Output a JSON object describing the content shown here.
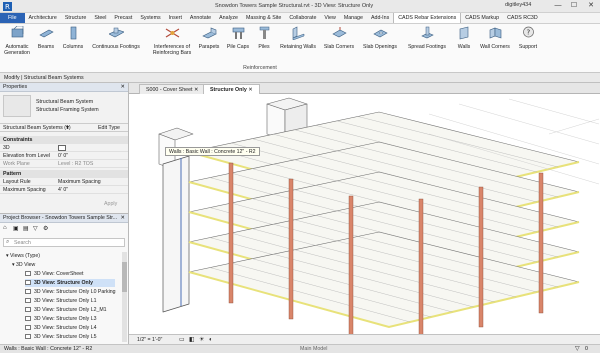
{
  "titlebar": {
    "title": "Snowdon Towers Sample Structural.rvt - 3D View: Structure Only",
    "user": "digitley434",
    "minimize": "—",
    "maximize": "☐",
    "close": "✕"
  },
  "tabs": [
    "File",
    "Architecture",
    "Structure",
    "Steel",
    "Precast",
    "Systems",
    "Insert",
    "Annotate",
    "Analyze",
    "Massing & Site",
    "Collaborate",
    "View",
    "Manage",
    "Add-Ins",
    "CADS Rebar Extensions",
    "CADS Markup",
    "CADS RC3D"
  ],
  "ribbon": {
    "buttons": [
      "Automatic Generation",
      "Beams",
      "Columns",
      "Continuous Footings",
      "Interferences of Reinforcing Bars",
      "Parapets",
      "Pile Caps",
      "Piles",
      "Retaining Walls",
      "Slab Corners",
      "Slab Openings",
      "Spread Footings",
      "Walls",
      "Wall Corners",
      "Support"
    ],
    "group_label": "Reinforcement"
  },
  "modbar": {
    "text": "Modify | Structural Beam Systems"
  },
  "properties": {
    "header": "Properties",
    "type_line1": "Structural Beam System",
    "type_line2": "Structural Framing System",
    "selector": "Structural Beam Systems (1)",
    "edit_type": "Edit Type",
    "cat_constraints": "Constraints",
    "rows_constraints": [
      {
        "k": "3D",
        "v": ""
      },
      {
        "k": "Elevation from Level",
        "v": "0'  0\""
      },
      {
        "k": "Work Plane",
        "v": "Level : R2 TOS"
      }
    ],
    "cat_pattern": "Pattern",
    "rows_pattern": [
      {
        "k": "Layout Rule",
        "v": "Maximum Spacing"
      },
      {
        "k": "Maximum Spacing",
        "v": "4'  0\""
      }
    ],
    "apply": "Apply"
  },
  "browser": {
    "header": "Project Browser - Snowdon Towers Sample Str...",
    "search_placeholder": "Search",
    "items": [
      {
        "label": "Views (Type)",
        "indent": 0
      },
      {
        "label": "3D View",
        "indent": 1
      },
      {
        "label": "3D View: CoverSheet",
        "indent": 2
      },
      {
        "label": "3D View: Structure Only",
        "indent": 2,
        "selected": true
      },
      {
        "label": "3D View: Structure Only L0 Parking",
        "indent": 2
      },
      {
        "label": "3D View: Structure Only L1",
        "indent": 2
      },
      {
        "label": "3D View: Structure Only L2_M1",
        "indent": 2
      },
      {
        "label": "3D View: Structure Only L3",
        "indent": 2
      },
      {
        "label": "3D View: Structure Only L4",
        "indent": 2
      },
      {
        "label": "3D View: Structure Only L5",
        "indent": 2
      }
    ]
  },
  "viewtabs": [
    "S000 - Cover Sheet",
    "Structure Only"
  ],
  "tooltip": "Walls : Basic Wall : Concrete 12\" - R2",
  "viewbar": {
    "scale": "1/2\" = 1'-0\""
  },
  "statusbar": {
    "text": "Walls : Basic Wall : Concrete 12\" - R2",
    "model": "Main Model",
    "filter": "0"
  },
  "colors": {
    "file_tab": "#2b63b5",
    "column": "#d9856a",
    "slab_edge": "#e8e27a",
    "beam": "#6c6c6c"
  }
}
